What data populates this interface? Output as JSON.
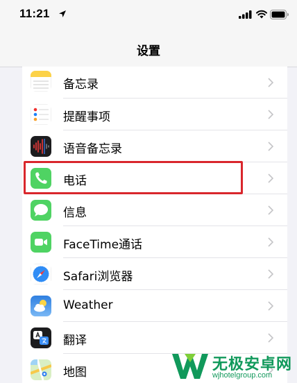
{
  "status_bar": {
    "time": "11:21",
    "icons": [
      "location-arrow-icon",
      "cellular-signal-icon",
      "wifi-icon",
      "battery-icon"
    ]
  },
  "nav": {
    "title": "设置"
  },
  "settings_rows": [
    {
      "label": "备忘录",
      "icon": "notes-app-icon"
    },
    {
      "label": "提醒事项",
      "icon": "reminders-app-icon"
    },
    {
      "label": "语音备忘录",
      "icon": "voice-memos-app-icon"
    },
    {
      "label": "电话",
      "icon": "phone-app-icon",
      "highlighted": true
    },
    {
      "label": "信息",
      "icon": "messages-app-icon"
    },
    {
      "label": "FaceTime通话",
      "icon": "facetime-app-icon"
    },
    {
      "label": "Safari浏览器",
      "icon": "safari-app-icon"
    },
    {
      "label": "Weather",
      "icon": "weather-app-icon"
    },
    {
      "label": "翻译",
      "icon": "translate-app-icon"
    },
    {
      "label": "地图",
      "icon": "maps-app-icon"
    }
  ],
  "watermark": {
    "name": "无极安卓网",
    "url": "wjhotelgroup.com"
  },
  "colors": {
    "highlight": "#d9262c",
    "watermark": "#11995b",
    "chevron": "#c4c4c7"
  }
}
